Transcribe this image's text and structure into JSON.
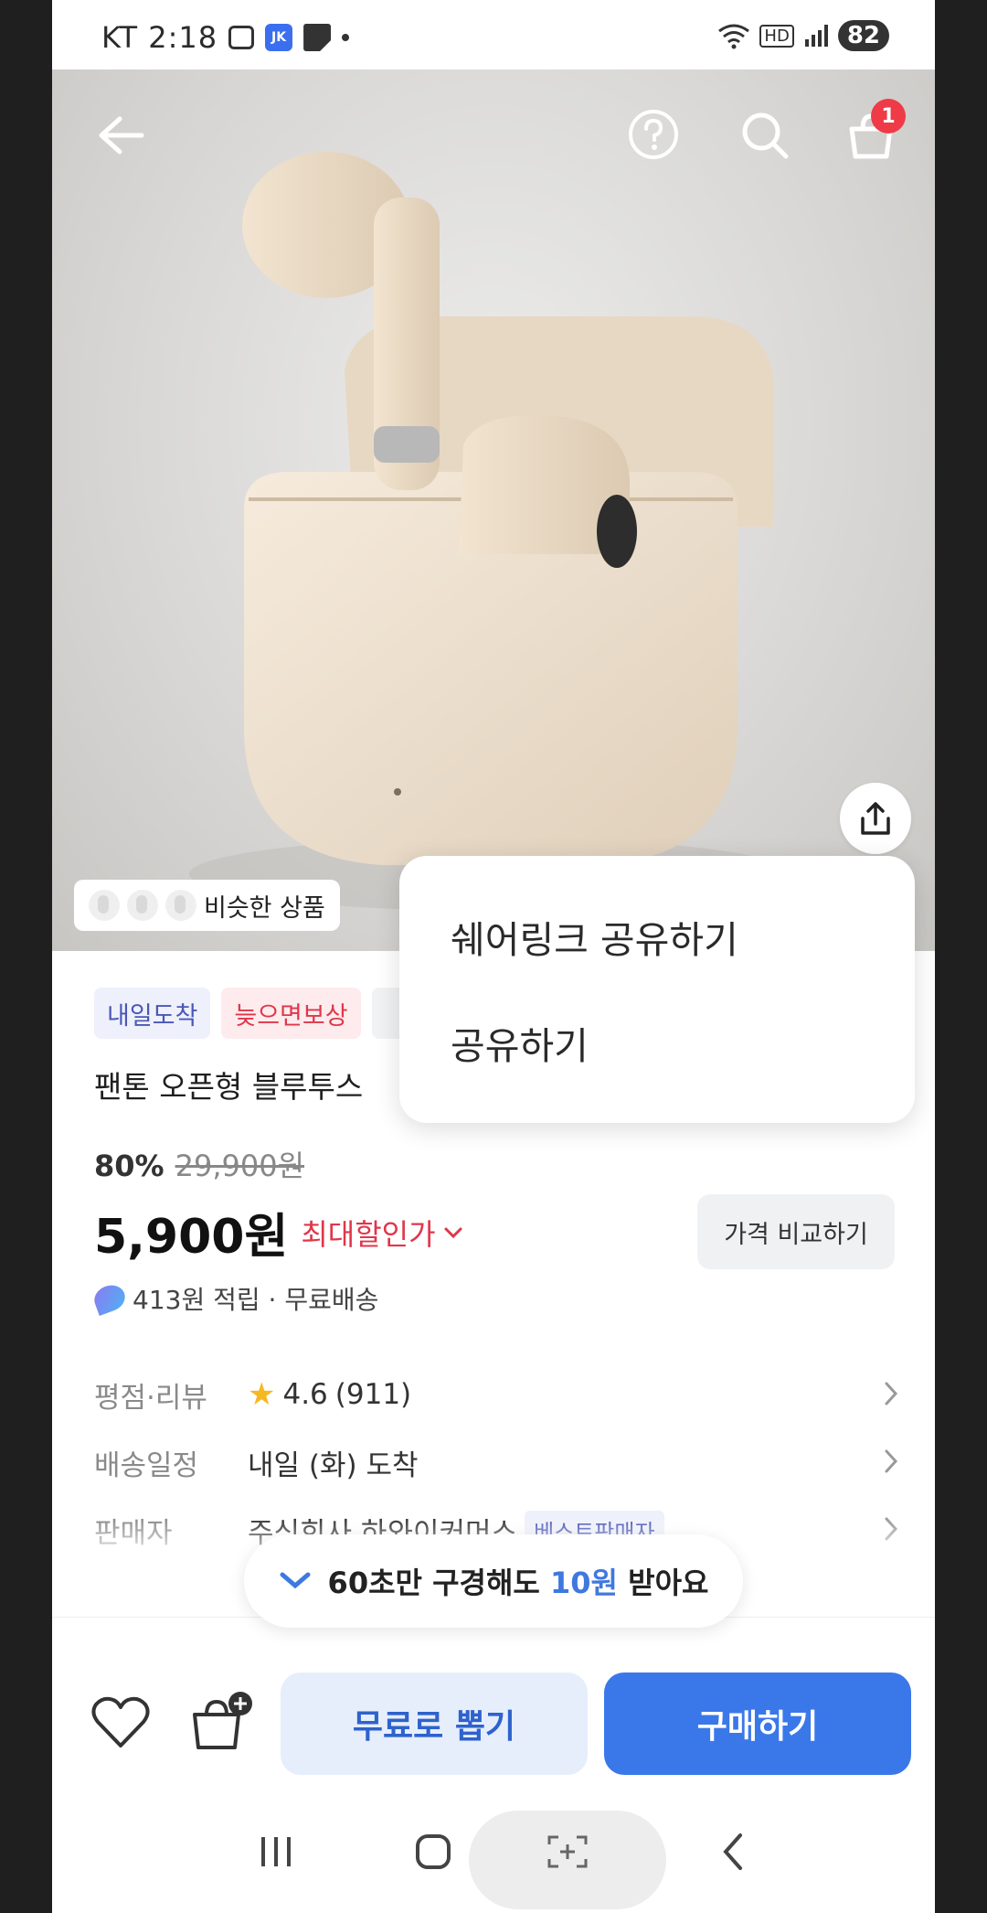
{
  "status_bar": {
    "carrier": "KT",
    "time": "2:18",
    "blue_icon_text": "JK",
    "hd_label": "HD",
    "battery": "82"
  },
  "header": {
    "cart_count": "1"
  },
  "hero": {
    "similar_products_label": "비슷한 상품"
  },
  "tags": [
    "내일도착",
    "늦으면보상"
  ],
  "product": {
    "title": "팬톤 오픈형 블루투스",
    "discount_percent": "80%",
    "original_price": "29,900원",
    "price": "5,900원",
    "max_discount_label": "최대할인가",
    "compare_button": "가격 비교하기",
    "points_text": "413원 적립 · 무료배송"
  },
  "info_rows": [
    {
      "label": "평점·리뷰",
      "rating": "4.6",
      "count": "(911)"
    },
    {
      "label": "배송일정",
      "value": "내일 (화) 도착"
    },
    {
      "label": "판매자",
      "value": "주식회사 하와이커머스",
      "badge": "베스트판매자"
    }
  ],
  "toast": {
    "prefix": "60초만 구경해도",
    "highlight": "10원",
    "suffix": "받아요"
  },
  "action_bar": {
    "free_button": "무료로 뽑기",
    "buy_button": "구매하기"
  },
  "share_menu": {
    "items": [
      "쉐어링크 공유하기",
      "공유하기"
    ]
  },
  "colors": {
    "primary": "#3a78ea",
    "accent_red": "#e0364a",
    "badge_red": "#ee3b47"
  }
}
